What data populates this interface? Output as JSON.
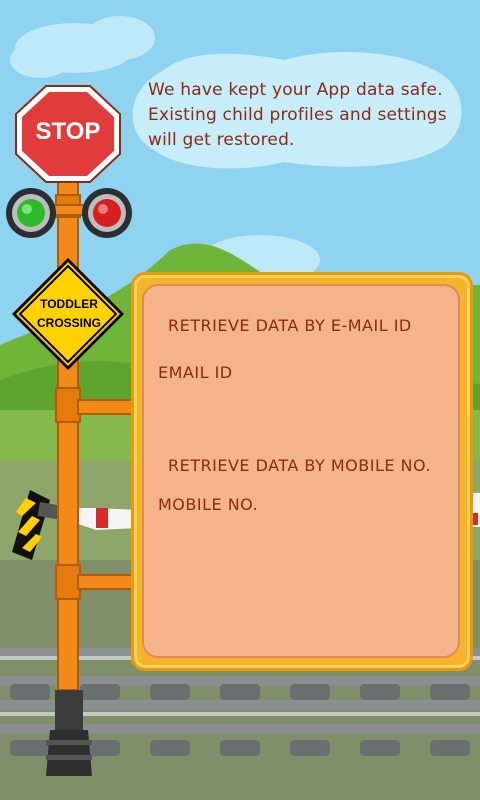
{
  "bubble": {
    "line1": "We have kept your App data safe.",
    "line2": "Existing child profiles and settings",
    "line3": "will get restored."
  },
  "signs": {
    "stop_label": "STOP",
    "crossing_line1": "TODDLER",
    "crossing_line2": "CROSSING"
  },
  "board": {
    "email_heading": "RETRIEVE DATA BY E-MAIL ID",
    "email_field_label": "EMAIL ID",
    "mobile_heading": "RETRIEVE DATA BY MOBILE NO.",
    "mobile_field_label": "MOBILE NO."
  },
  "colors": {
    "sky": "#8fd3f0",
    "text_brown": "#8a2b12",
    "board_orange": "#f7b32b",
    "board_inner": "#f4b388",
    "stop_red": "#e23b3b",
    "crossing_yellow": "#ffd100"
  },
  "icons": {
    "stop_sign": "stop-sign-icon",
    "green_light": "green-light-icon",
    "red_light": "red-light-icon",
    "crossing_sign": "crossing-sign-icon"
  }
}
